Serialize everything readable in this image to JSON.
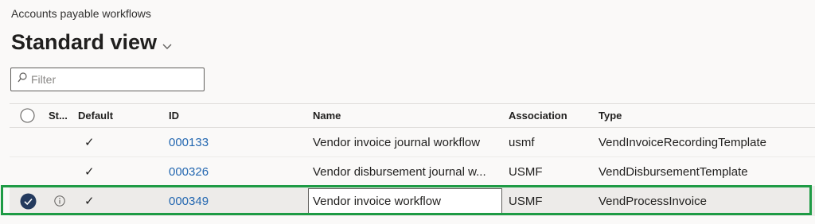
{
  "header": {
    "app_title": "Accounts payable workflows",
    "view_title": "Standard view"
  },
  "filter": {
    "placeholder": "Filter"
  },
  "columns": {
    "status": "St...",
    "default": "Default",
    "id": "ID",
    "name": "Name",
    "association": "Association",
    "type": "Type"
  },
  "rows": [
    {
      "id": "000133",
      "name": "Vendor invoice journal workflow",
      "association": "usmf",
      "type": "VendInvoiceRecordingTemplate",
      "default": "✓"
    },
    {
      "id": "000326",
      "name": "Vendor disbursement journal w...",
      "association": "USMF",
      "type": "VendDisbursementTemplate",
      "default": "✓"
    },
    {
      "id": "000349",
      "name": "Vendor invoice workflow",
      "association": "USMF",
      "type": "VendProcessInvoice",
      "default": "✓",
      "selected": true
    }
  ],
  "colors": {
    "accent": "#2266b0",
    "highlight": "#1e9b45",
    "check_fill": "#243a5e"
  },
  "icons": [
    "search-icon",
    "chevron-down-icon",
    "select-all-circle-icon",
    "checkmark-icon",
    "info-icon",
    "selected-check-icon"
  ]
}
